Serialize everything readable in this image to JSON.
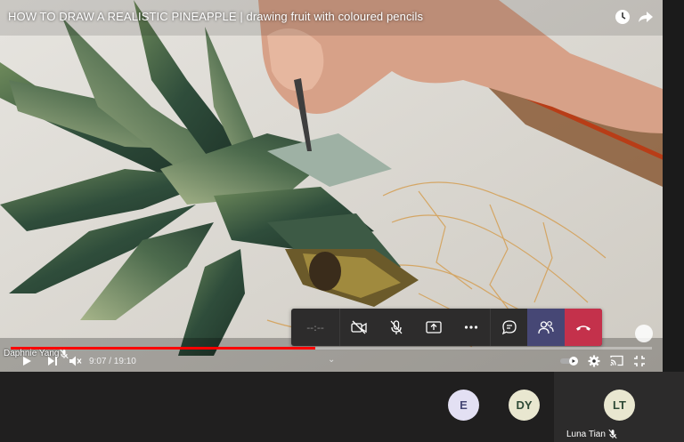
{
  "video": {
    "title": "HOW TO DRAW A REALISTIC PINEAPPLE | drawing fruit with coloured pencils",
    "time_display": "9:07 / 19:10",
    "progress_fraction": 0.475,
    "chevron": "⌄"
  },
  "presenter": {
    "name": "Daphnie Yang"
  },
  "meeting_toolbar": {
    "timer": "--:--",
    "buttons": [
      "camera-off",
      "mic-off",
      "share-screen",
      "more",
      "chat",
      "participants",
      "hang-up"
    ]
  },
  "participants": [
    {
      "initials": "E"
    },
    {
      "initials": "DY"
    },
    {
      "initials": "LT",
      "name": "Luna Tian"
    }
  ],
  "colors": {
    "progress": "#ff0000",
    "hangup": "#c4314b",
    "people_active": "#464775"
  }
}
